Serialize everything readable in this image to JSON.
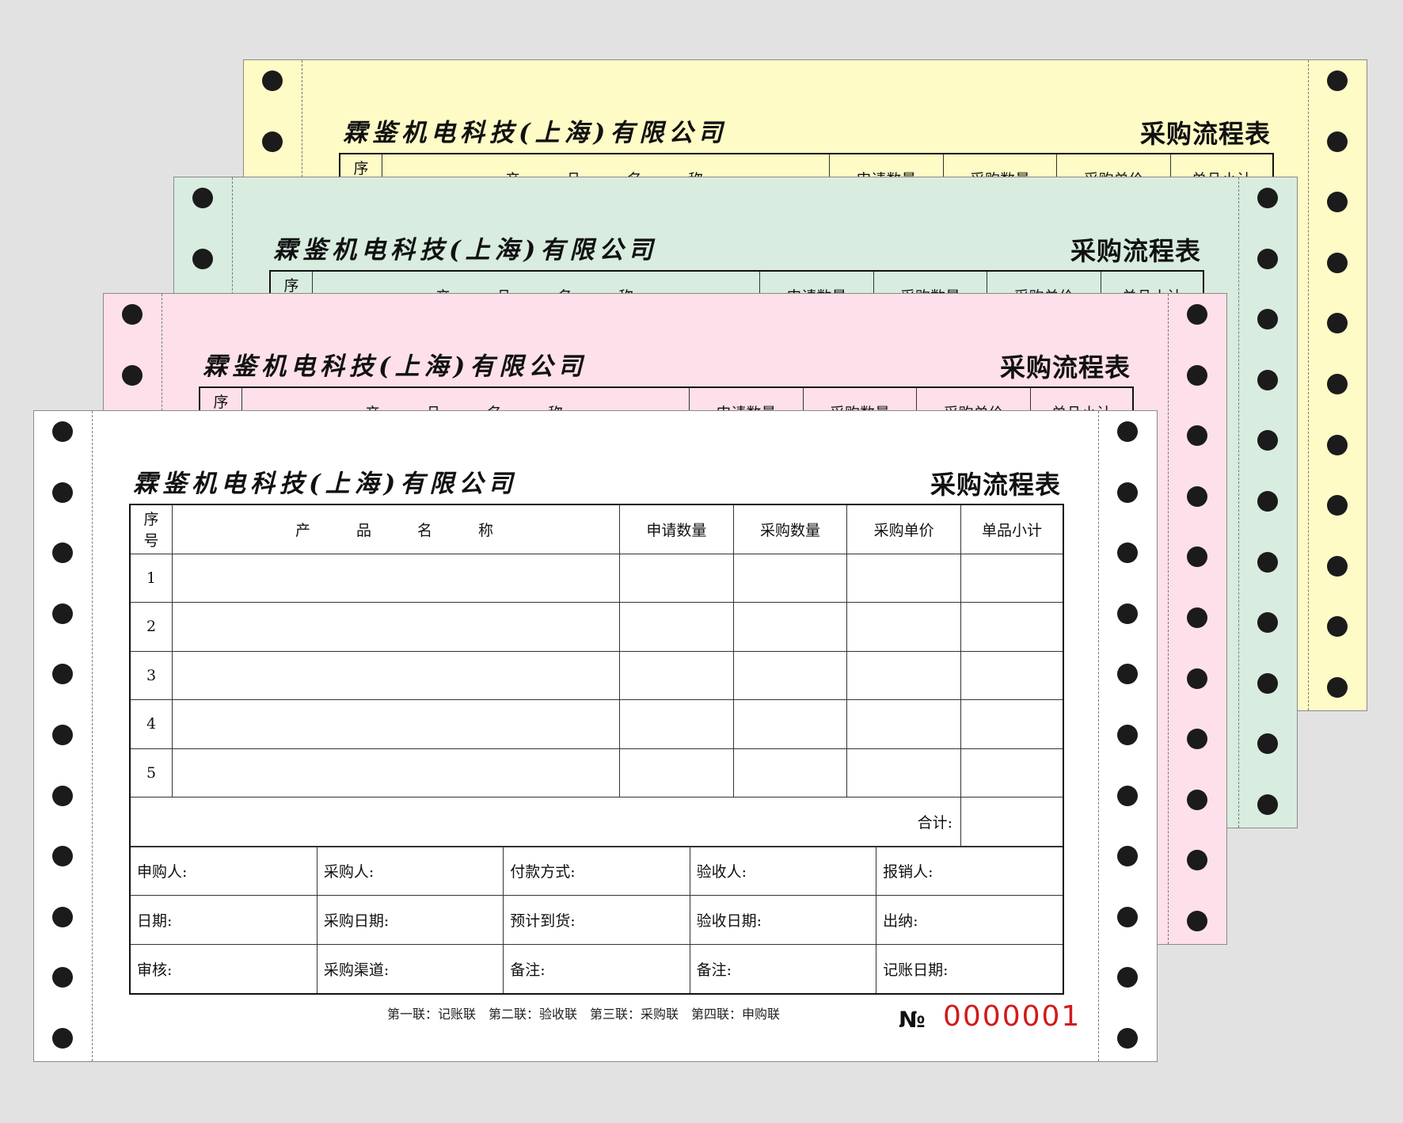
{
  "form": {
    "company": "霖鉴机电科技(上海)有限公司",
    "title": "采购流程表",
    "columns": {
      "seq": "序号",
      "product": "产 品 名 称",
      "requested_qty": "申请数量",
      "purchase_qty": "采购数量",
      "unit_price": "采购单价",
      "subtotal": "单品小计"
    },
    "rows": [
      "1",
      "2",
      "3",
      "4",
      "5"
    ],
    "total_label": "合计:",
    "signatures": [
      [
        "申购人:",
        "采购人:",
        "付款方式:",
        "验收人:",
        "报销人:"
      ],
      [
        "日期:",
        "采购日期:",
        "预计到货:",
        "验收日期:",
        "出纳:"
      ],
      [
        "审核:",
        "采购渠道:",
        "备注:",
        "备注:",
        "记账日期:"
      ]
    ],
    "copies_note": "第一联：记账联　第二联：验收联　第三联：采购联　第四联：申购联",
    "serial_label": "№",
    "serial_number": "0000001"
  },
  "colors": {
    "sheet_yellow": "#fefbc6",
    "sheet_green": "#d8ece0",
    "sheet_pink": "#fde0ea",
    "sheet_white": "#ffffff",
    "serial_red": "#d01b1b"
  }
}
